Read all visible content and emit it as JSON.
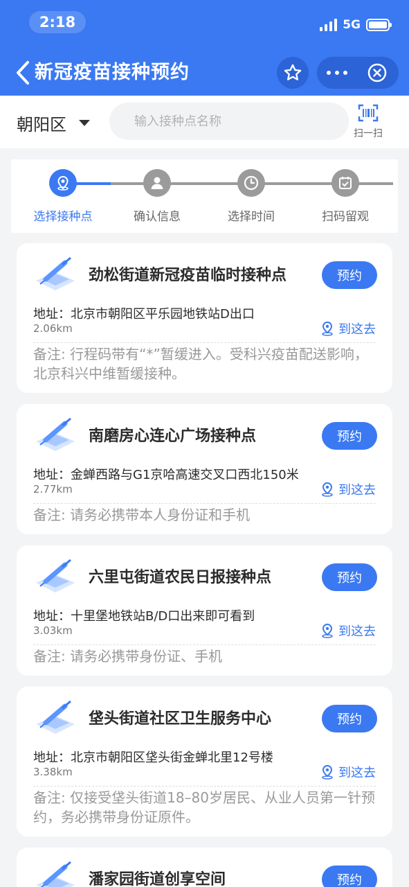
{
  "status_bar": {
    "time": "2:18",
    "network": "5G"
  },
  "nav": {
    "title": "新冠疫苗接种预约"
  },
  "search": {
    "district": "朝阳区",
    "placeholder": "输入接种点名称",
    "scan_label": "扫一扫"
  },
  "steps": [
    {
      "label": "选择接种点",
      "icon": "location-icon",
      "active": true
    },
    {
      "label": "确认信息",
      "icon": "user-icon",
      "active": false
    },
    {
      "label": "选择时间",
      "icon": "clock-icon",
      "active": false
    },
    {
      "label": "扫码留观",
      "icon": "calendar-check-icon",
      "active": false
    }
  ],
  "sites": [
    {
      "name": "劲松街道新冠疫苗临时接种点",
      "book": "预约",
      "address": "地址：北京市朝阳区平乐园地铁站D出口",
      "distance": "2.06km",
      "goto": "到这去",
      "note": "备注: 行程码带有“*”暂缓进入。受科兴疫苗配送影响，北京科兴中维暂缓接种。"
    },
    {
      "name": "南磨房心连心广场接种点",
      "book": "预约",
      "address": "地址：金蝉西路与G1京哈高速交叉口西北150米",
      "distance": "2.77km",
      "goto": "到这去",
      "note": "备注: 请务必携带本人身份证和手机"
    },
    {
      "name": "六里屯街道农民日报接种点",
      "book": "预约",
      "address": "地址：十里堡地铁站B/D口出来即可看到",
      "distance": "3.03km",
      "goto": "到这去",
      "note": "备注: 请务必携带身份证、手机"
    },
    {
      "name": "垡头街道社区卫生服务中心",
      "book": "预约",
      "address": "地址：北京市朝阳区垡头街金蝉北里12号楼",
      "distance": "3.38km",
      "goto": "到这去",
      "note": "备注: 仅接受垡头街道18–80岁居民、从业人员第一针预约，务必携带身份证原件。"
    },
    {
      "name": "潘家园街道创享空间",
      "book": "预约"
    }
  ],
  "colors": {
    "primary": "#3a79f2",
    "nav_bg": "#3a79f2",
    "muted": "#999999"
  }
}
